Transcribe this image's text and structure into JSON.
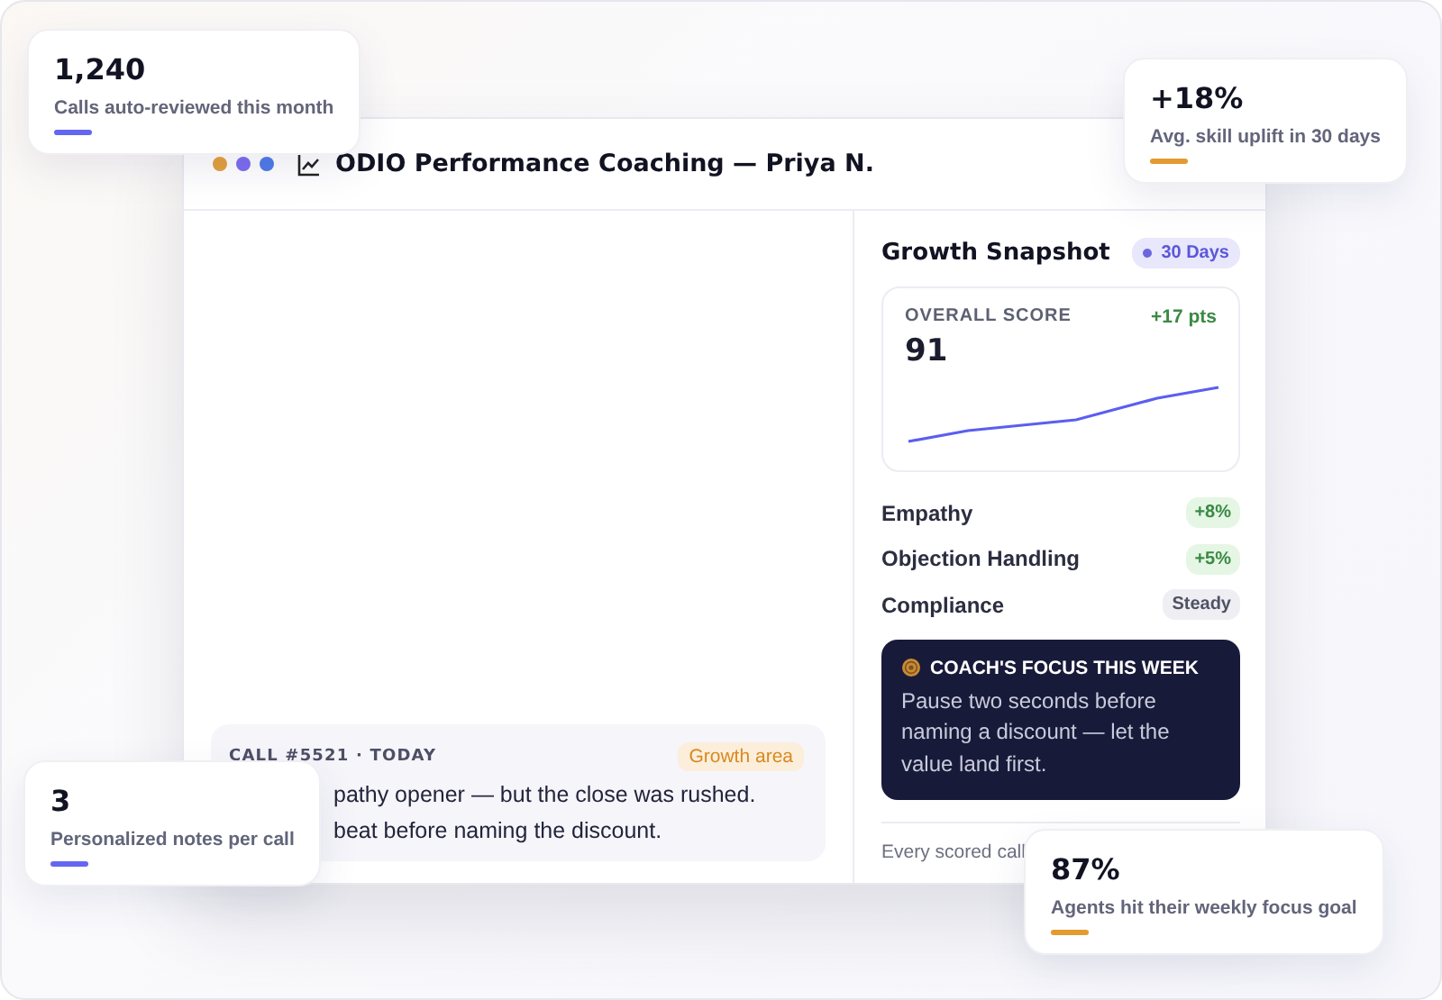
{
  "stat_cards": [
    {
      "value": "1,240",
      "label": "Calls auto-reviewed this month",
      "color": "#6366f1"
    },
    {
      "value": "+18%",
      "label": "Avg. skill uplift in 30 days",
      "color": "#e39b32"
    },
    {
      "value": "3",
      "label": "Personalized notes per call",
      "color": "#6366f1"
    },
    {
      "value": "87%",
      "label": "Agents hit their weekly focus goal",
      "color": "#e39b32"
    }
  ],
  "window": {
    "title": "ODIO Performance Coaching — Priya N."
  },
  "call_card": {
    "meta": "CALL #5521 · TODAY",
    "tag": "Growth area",
    "lines": [
      "pathy opener — but the close was rushed.",
      "beat before naming the discount."
    ]
  },
  "snapshot": {
    "title": "Growth Snapshot",
    "period": "30 Days",
    "score_label": "OVERALL SCORE",
    "score_change": "+17 pts",
    "score": "91",
    "skills": [
      {
        "name": "Empathy",
        "change": "+8%",
        "kind": "up"
      },
      {
        "name": "Objection Handling",
        "change": "+5%",
        "kind": "up"
      },
      {
        "name": "Compliance",
        "change": "Steady",
        "kind": "steady"
      }
    ],
    "focus": {
      "title": "COACH'S FOCUS THIS WEEK",
      "text": "Pause two seconds before naming a discount — let the value land first."
    },
    "footnote": "Every scored call"
  }
}
